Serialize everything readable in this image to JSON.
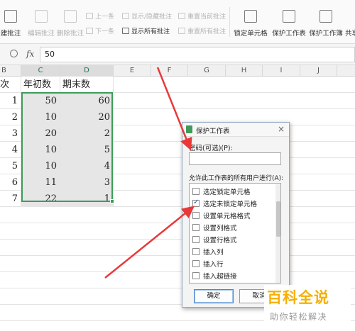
{
  "ribbon": {
    "big_buttons": [
      {
        "label": "建批注",
        "enabled": true
      },
      {
        "label": "编辑批注",
        "enabled": false
      },
      {
        "label": "删除批注",
        "enabled": false
      },
      {
        "label": "锁定单元格",
        "enabled": true
      },
      {
        "label": "保护工作表",
        "enabled": true
      },
      {
        "label": "保护工作簿",
        "enabled": true
      },
      {
        "label": "共享",
        "enabled": true
      }
    ],
    "small_buttons": [
      {
        "label": "上一条",
        "enabled": false
      },
      {
        "label": "下一条",
        "enabled": false
      },
      {
        "label": "显示/隐藏批注",
        "enabled": false
      },
      {
        "label": "显示所有批注",
        "enabled": true
      },
      {
        "label": "重置当前批注",
        "enabled": false
      },
      {
        "label": "重置所有批注",
        "enabled": false
      }
    ]
  },
  "formula_bar": {
    "fx_symbol": "fx",
    "value": "50"
  },
  "columns": [
    "B",
    "C",
    "D",
    "E",
    "F",
    "G",
    "H",
    "I",
    "J"
  ],
  "selected_columns": [
    "C",
    "D"
  ],
  "sheet": {
    "header_row": {
      "b": "次",
      "c": "年初数",
      "d": "期末数"
    },
    "rows": [
      {
        "b": "1",
        "c": "50",
        "d": "60"
      },
      {
        "b": "2",
        "c": "10",
        "d": "20"
      },
      {
        "b": "3",
        "c": "20",
        "d": "2"
      },
      {
        "b": "4",
        "c": "10",
        "d": "5"
      },
      {
        "b": "5",
        "c": "10",
        "d": "4"
      },
      {
        "b": "6",
        "c": "11",
        "d": "3"
      },
      {
        "b": "7",
        "c": "22",
        "d": "1"
      }
    ]
  },
  "dialog": {
    "title": "保护工作表",
    "close_symbol": "×",
    "password_label": "密码(可选)(P):",
    "password_value": "",
    "permissions_label": "允许此工作表的所有用户进行(A):",
    "options": [
      {
        "label": "选定锁定单元格",
        "checked": false
      },
      {
        "label": "选定未锁定单元格",
        "checked": true
      },
      {
        "label": "设置单元格格式",
        "checked": false
      },
      {
        "label": "设置列格式",
        "checked": false
      },
      {
        "label": "设置行格式",
        "checked": false
      },
      {
        "label": "插入列",
        "checked": false
      },
      {
        "label": "插入行",
        "checked": false
      },
      {
        "label": "插入超链接",
        "checked": false
      }
    ],
    "ok_label": "确定",
    "cancel_label": "取消"
  },
  "colors": {
    "selection": "#3f9b59",
    "arrow": "#e8393a",
    "watermark_title": "#f7b000"
  },
  "watermark": {
    "title": "百科全说",
    "subtitle": "助你轻松解决"
  }
}
